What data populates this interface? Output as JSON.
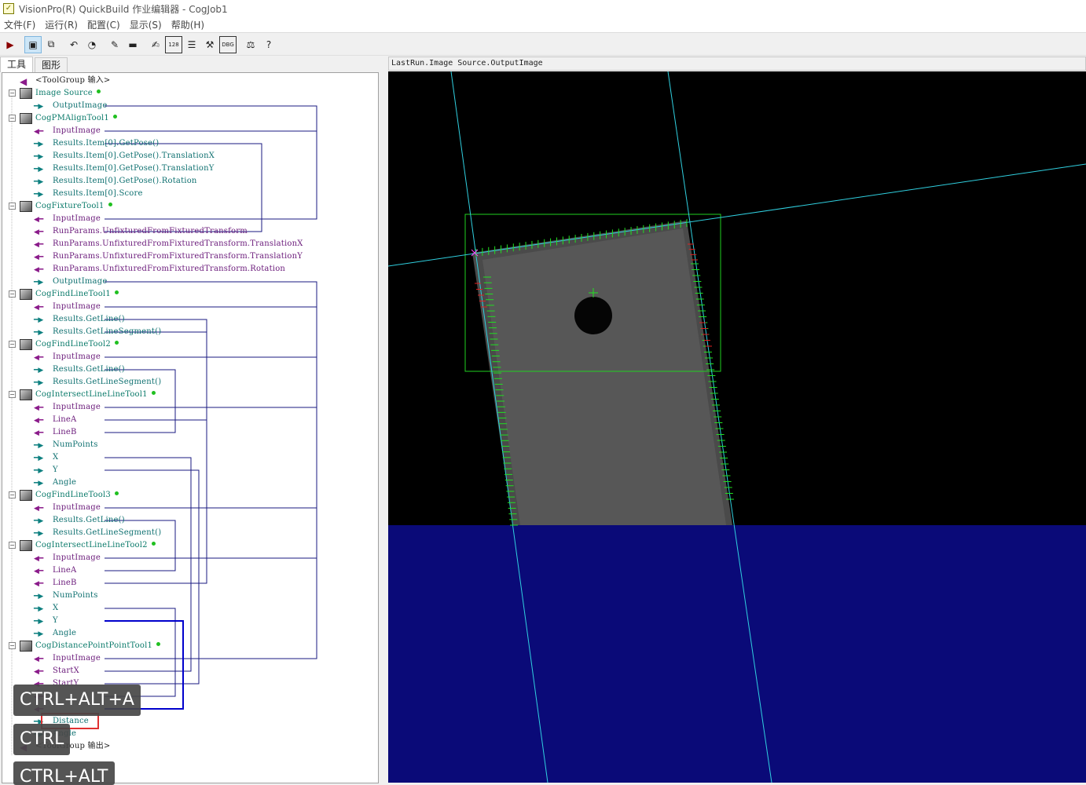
{
  "window": {
    "title": "VisionPro(R) QuickBuild 作业编辑器 - CogJob1"
  },
  "menu": [
    {
      "label": "文件(F)"
    },
    {
      "label": "运行(R)"
    },
    {
      "label": "配置(C)"
    },
    {
      "label": "显示(S)"
    },
    {
      "label": "帮助(H)"
    }
  ],
  "toolbar": {
    "buttons": [
      {
        "icon": "run-triangle-icon",
        "glyph": "▶"
      },
      {
        "icon": "image-display-icon",
        "glyph": "▣"
      },
      {
        "icon": "copy-window-icon",
        "glyph": "⧉"
      },
      {
        "icon": "reset-arrow-icon",
        "glyph": "↶"
      },
      {
        "icon": "realtime-icon",
        "glyph": "◔"
      },
      {
        "icon": "pen-icon",
        "glyph": "✎"
      },
      {
        "icon": "gun-icon",
        "glyph": "▬"
      },
      {
        "icon": "edit-note-icon",
        "glyph": "✍"
      },
      {
        "icon": "counter-128-icon",
        "glyph": "128"
      },
      {
        "icon": "list-window-icon",
        "glyph": "☰"
      },
      {
        "icon": "tools-icon",
        "glyph": "⚒"
      },
      {
        "icon": "dbg-icon",
        "glyph": "DBG"
      },
      {
        "icon": "scale-icon",
        "glyph": "⚖"
      },
      {
        "icon": "help-icon",
        "glyph": "?"
      }
    ]
  },
  "left_tabs": [
    {
      "label": "工具"
    },
    {
      "label": "图形"
    }
  ],
  "tree": {
    "rows": [
      {
        "label": "<ToolGroup 输入>",
        "kind": "group"
      },
      {
        "label": "Image Source",
        "kind": "tool",
        "status": "ok"
      },
      {
        "label": "OutputImage",
        "kind": "out"
      },
      {
        "label": "CogPMAlignTool1",
        "kind": "tool",
        "status": "ok"
      },
      {
        "label": "InputImage",
        "kind": "in"
      },
      {
        "label": "Results.Item[0].GetPose()",
        "kind": "out"
      },
      {
        "label": "Results.Item[0].GetPose().TranslationX",
        "kind": "out"
      },
      {
        "label": "Results.Item[0].GetPose().TranslationY",
        "kind": "out"
      },
      {
        "label": "Results.Item[0].GetPose().Rotation",
        "kind": "out"
      },
      {
        "label": "Results.Item[0].Score",
        "kind": "out"
      },
      {
        "label": "CogFixtureTool1",
        "kind": "tool",
        "status": "ok"
      },
      {
        "label": "InputImage",
        "kind": "in"
      },
      {
        "label": "RunParams.UnfixturedFromFixturedTransform",
        "kind": "in"
      },
      {
        "label": "RunParams.UnfixturedFromFixturedTransform.TranslationX",
        "kind": "in"
      },
      {
        "label": "RunParams.UnfixturedFromFixturedTransform.TranslationY",
        "kind": "in"
      },
      {
        "label": "RunParams.UnfixturedFromFixturedTransform.Rotation",
        "kind": "in"
      },
      {
        "label": "OutputImage",
        "kind": "out"
      },
      {
        "label": "CogFindLineTool1",
        "kind": "tool",
        "status": "ok"
      },
      {
        "label": "InputImage",
        "kind": "in"
      },
      {
        "label": "Results.GetLine()",
        "kind": "out"
      },
      {
        "label": "Results.GetLineSegment()",
        "kind": "out"
      },
      {
        "label": "CogFindLineTool2",
        "kind": "tool",
        "status": "ok"
      },
      {
        "label": "InputImage",
        "kind": "in"
      },
      {
        "label": "Results.GetLine()",
        "kind": "out"
      },
      {
        "label": "Results.GetLineSegment()",
        "kind": "out"
      },
      {
        "label": "CogIntersectLineLineTool1",
        "kind": "tool",
        "status": "ok"
      },
      {
        "label": "InputImage",
        "kind": "in"
      },
      {
        "label": "LineA",
        "kind": "in"
      },
      {
        "label": "LineB",
        "kind": "in"
      },
      {
        "label": "NumPoints",
        "kind": "out"
      },
      {
        "label": "X",
        "kind": "out"
      },
      {
        "label": "Y",
        "kind": "out"
      },
      {
        "label": "Angle",
        "kind": "out"
      },
      {
        "label": "CogFindLineTool3",
        "kind": "tool",
        "status": "ok"
      },
      {
        "label": "InputImage",
        "kind": "in"
      },
      {
        "label": "Results.GetLine()",
        "kind": "out"
      },
      {
        "label": "Results.GetLineSegment()",
        "kind": "out"
      },
      {
        "label": "CogIntersectLineLineTool2",
        "kind": "tool",
        "status": "ok"
      },
      {
        "label": "InputImage",
        "kind": "in"
      },
      {
        "label": "LineA",
        "kind": "in"
      },
      {
        "label": "LineB",
        "kind": "in"
      },
      {
        "label": "NumPoints",
        "kind": "out"
      },
      {
        "label": "X",
        "kind": "out"
      },
      {
        "label": "Y",
        "kind": "out"
      },
      {
        "label": "Angle",
        "kind": "out"
      },
      {
        "label": "CogDistancePointPointTool1",
        "kind": "tool",
        "status": "ok"
      },
      {
        "label": "InputImage",
        "kind": "in"
      },
      {
        "label": "StartX",
        "kind": "in"
      },
      {
        "label": "StartY",
        "kind": "in"
      },
      {
        "label": "",
        "kind": "in"
      },
      {
        "label": "",
        "kind": "in"
      },
      {
        "label": "Distance",
        "kind": "out"
      },
      {
        "label": "Angle",
        "kind": "out"
      },
      {
        "label": "<ToolGroup 输出>",
        "kind": "group"
      }
    ]
  },
  "image_view": {
    "header": "LastRun.Image Source.OutputImage"
  },
  "hotkeys": [
    {
      "label": "CTRL+ALT+A"
    },
    {
      "label": "CTRL"
    },
    {
      "label": "CTRL+ALT"
    }
  ],
  "colors": {
    "found_edge": "#20e020",
    "outlier_edge": "#e02020",
    "fit_line": "#30d0e0",
    "region_box": "#20d020",
    "background_region": "#0a0a78",
    "link_line": "#1a1a80",
    "highlight_link": "#0000cc"
  }
}
